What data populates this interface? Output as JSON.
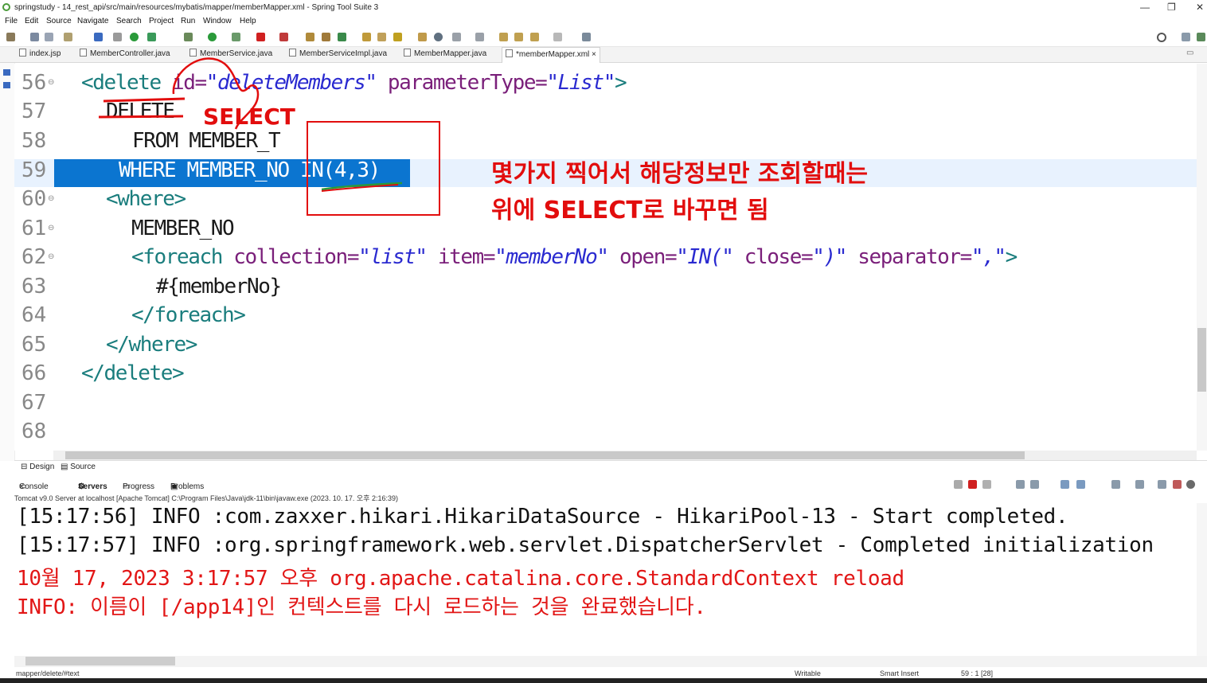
{
  "window": {
    "title": "springstudy - 14_rest_api/src/main/resources/mybatis/mapper/memberMapper.xml - Spring Tool Suite 3",
    "minimize": "—",
    "restore": "❐",
    "close": "✕"
  },
  "menu": [
    "File",
    "Edit",
    "Source",
    "Navigate",
    "Search",
    "Project",
    "Run",
    "Window",
    "Help"
  ],
  "tabs": [
    {
      "label": "index.jsp"
    },
    {
      "label": "MemberController.java"
    },
    {
      "label": "MemberService.java"
    },
    {
      "label": "MemberServiceImpl.java"
    },
    {
      "label": "MemberMapper.java"
    },
    {
      "label": "*memberMapper.xml",
      "close": "×"
    }
  ],
  "editor": {
    "lines": [
      {
        "n": "56",
        "fold": "⊖"
      },
      {
        "n": "57"
      },
      {
        "n": "58"
      },
      {
        "n": "59"
      },
      {
        "n": "60",
        "fold": "⊖"
      },
      {
        "n": "61",
        "fold": "⊖"
      },
      {
        "n": "62",
        "fold": "⊖"
      },
      {
        "n": "63"
      },
      {
        "n": "64"
      },
      {
        "n": "65"
      },
      {
        "n": "66"
      },
      {
        "n": "67"
      },
      {
        "n": "68"
      }
    ],
    "code": {
      "l56_open": "<delete ",
      "l56_attr1": "id=",
      "l56_val1": "\"deleteMembers\"",
      "l56_attr2": " parameterType=",
      "l56_val2": "\"List\"",
      "l56_close": ">",
      "l57": "DELETE",
      "l58": "FROM MEMBER_T",
      "l59": "WHERE MEMBER_NO IN(4,3)",
      "l60": "<where>",
      "l61": "MEMBER_NO",
      "l62_open": "<foreach ",
      "l62_a1": "collection=",
      "l62_v1": "\"list\"",
      "l62_a2": " item=",
      "l62_v2": "\"memberNo\"",
      "l62_a3": " open=",
      "l62_v3": "\"IN(\"",
      "l62_a4": " close=",
      "l62_v4": "\")\"",
      "l62_a5": " separator=",
      "l62_v5": "\",\"",
      "l62_close": ">",
      "l63": "#{memberNo}",
      "l64": "</foreach>",
      "l65": "</where>",
      "l66": "</delete>"
    }
  },
  "annotations": {
    "select": "SELECT",
    "note_line1": "몇가지 찍어서 해당정보만 조회할때는",
    "note_line2": "위에 SELECT로 바꾸면 됨"
  },
  "bottom_tabs": {
    "design": "Design",
    "source": "Source"
  },
  "console_tabs": [
    "Console",
    "Servers",
    "Progress",
    "Problems"
  ],
  "console_tab_close": "×",
  "server_line": "Tomcat v9.0 Server at localhost [Apache Tomcat] C:\\Program Files\\Java\\jdk-11\\bin\\javaw.exe  (2023. 10. 17. 오후 2:16:39)",
  "console_lines": [
    {
      "text": "[15:17:56] INFO :com.zaxxer.hikari.HikariDataSource - HikariPool-13 - Start completed.",
      "color": "#111111"
    },
    {
      "text": "[15:17:57] INFO :org.springframework.web.servlet.DispatcherServlet - Completed initialization",
      "color": "#111111"
    },
    {
      "text": "10월 17, 2023 3:17:57 오후 org.apache.catalina.core.StandardContext reload",
      "color": "#e21616"
    },
    {
      "text": "INFO: 이름이 [/app14]인 컨텍스트를 다시 로드하는 것을 완료했습니다.",
      "color": "#e21616"
    }
  ],
  "status": {
    "path": "mapper/delete/#text",
    "writable": "Writable",
    "insert_mode": "Smart Insert",
    "position": "59 : 1 [28]"
  },
  "colors": {
    "selection": "#0b75d0",
    "current_line": "#e8f2fe",
    "tag": "#1a7d7d",
    "attribute": "#7a1f7a",
    "value": "#2a2ad0",
    "annotation": "#e20d0d"
  }
}
